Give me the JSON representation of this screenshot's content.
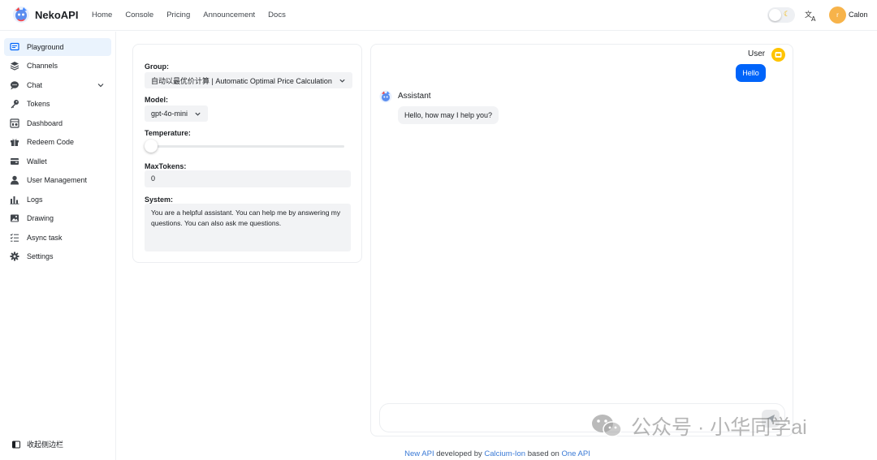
{
  "header": {
    "brand": "NekoAPI",
    "nav": [
      "Home",
      "Console",
      "Pricing",
      "Announcement",
      "Docs"
    ],
    "avatar_letter": "r",
    "username": "Calon"
  },
  "sidebar": {
    "items": [
      {
        "label": "Playground",
        "icon": "chat-square-icon",
        "active": true
      },
      {
        "label": "Channels",
        "icon": "layers-icon"
      },
      {
        "label": "Chat",
        "icon": "chat-bubble-icon",
        "expandable": true
      },
      {
        "label": "Tokens",
        "icon": "key-icon"
      },
      {
        "label": "Dashboard",
        "icon": "dashboard-icon"
      },
      {
        "label": "Redeem Code",
        "icon": "gift-icon"
      },
      {
        "label": "Wallet",
        "icon": "wallet-icon"
      },
      {
        "label": "User Management",
        "icon": "user-icon"
      },
      {
        "label": "Logs",
        "icon": "bar-chart-icon"
      },
      {
        "label": "Drawing",
        "icon": "image-icon"
      },
      {
        "label": "Async task",
        "icon": "task-list-icon"
      },
      {
        "label": "Settings",
        "icon": "gear-icon"
      }
    ],
    "collapse_label": "收起侧边栏"
  },
  "settings": {
    "group_label": "Group:",
    "group_value": "自动以最优价计算 | Automatic Optimal Price Calculation",
    "model_label": "Model:",
    "model_value": "gpt-4o-mini",
    "temperature_label": "Temperature:",
    "temperature_value": 0,
    "maxtokens_label": "MaxTokens:",
    "maxtokens_value": "0",
    "system_label": "System:",
    "system_value": "You are a helpful assistant. You can help me by answering my questions. You can also ask me questions."
  },
  "chat": {
    "user_name": "User",
    "user_message": "Hello",
    "assistant_name": "Assistant",
    "assistant_message": "Hello, how may I help you?"
  },
  "watermark": "公众号 · 小华同学ai",
  "footer": {
    "link1": "New API",
    "text1": " developed by ",
    "link2": "Calcium-Ion",
    "text2": " based on ",
    "link3": "One API"
  },
  "colors": {
    "accent": "#0064fa",
    "active_bg": "#eaf3fd",
    "link": "#3a7ad6"
  }
}
